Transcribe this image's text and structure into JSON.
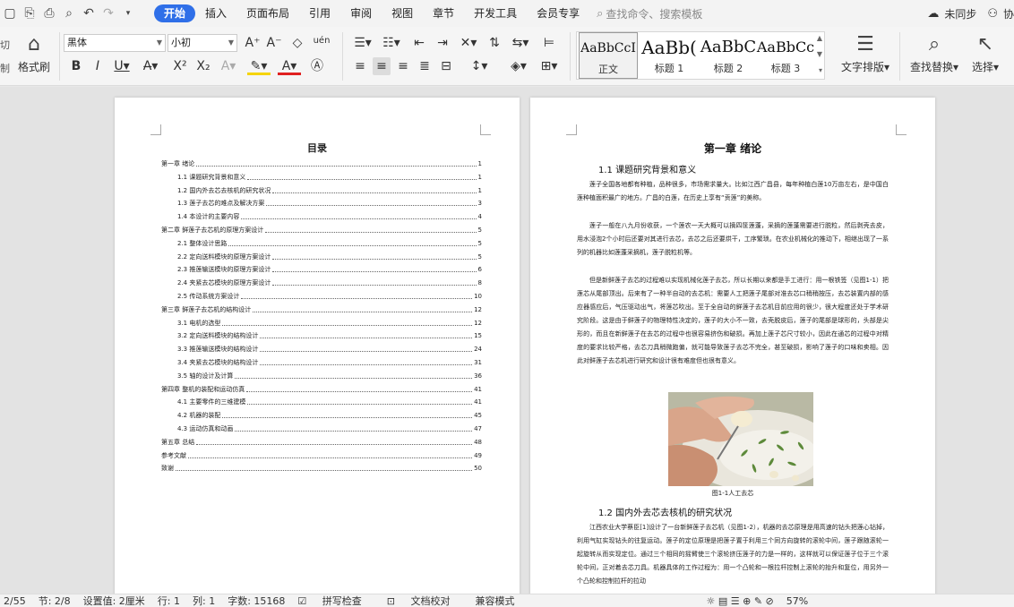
{
  "menu": {
    "tabs": [
      "开始",
      "插入",
      "页面布局",
      "引用",
      "审阅",
      "视图",
      "章节",
      "开发工具",
      "会员专享"
    ],
    "search_placeholder": "查找命令、搜索模板",
    "sync": "未同步",
    "collab": "协"
  },
  "ribbon": {
    "cut": "切",
    "copy": "制",
    "format_painter": "格式刷",
    "font_name": "黑体",
    "font_size": "小初",
    "phonetic": "uén",
    "styles": [
      {
        "preview": "AaBbCcI",
        "label": "正文"
      },
      {
        "preview": "AaBb(",
        "label": "标题 1"
      },
      {
        "preview": "AaBbC",
        "label": "标题 2"
      },
      {
        "preview": "AaBbCc",
        "label": "标题 3"
      }
    ],
    "text_layout": "文字排版",
    "find_replace": "查找替换",
    "select": "选择"
  },
  "toc": {
    "title": "目录",
    "items": [
      {
        "label": "第一章  绪论",
        "page": "1"
      },
      {
        "label": "1.1    课题研究背景和意义",
        "page": "1"
      },
      {
        "label": "1.2    国内外去芯去核机的研究状况",
        "page": "1"
      },
      {
        "label": "1.3    莲子去芯的难点及解决方案",
        "page": "3"
      },
      {
        "label": "1.4    本设计的主要内容",
        "page": "4"
      },
      {
        "label": "第二章  鲜莲子去芯机的原理方案设计",
        "page": "5"
      },
      {
        "label": "2.1    整体设计思路",
        "page": "5"
      },
      {
        "label": "2.2    定向送料模块的原理方案设计",
        "page": "5"
      },
      {
        "label": "2.3    推莲输送模块的原理方案设计",
        "page": "6"
      },
      {
        "label": "2.4    夹紧去芯模块的原理方案设计",
        "page": "8"
      },
      {
        "label": "2.5    传动系统方案设计",
        "page": "10"
      },
      {
        "label": "第三章  鲜莲子去芯机的结构设计",
        "page": "12"
      },
      {
        "label": "3.1    电机的选型",
        "page": "12"
      },
      {
        "label": "3.2    定向送料模块的结构设计",
        "page": "15"
      },
      {
        "label": "3.3    推莲输送模块的结构设计",
        "page": "24"
      },
      {
        "label": "3.4    夹紧去芯模块的结构设计",
        "page": "31"
      },
      {
        "label": "3.5    轴的设计及计算",
        "page": "36"
      },
      {
        "label": "第四章  整机的装配和运动仿真",
        "page": "41"
      },
      {
        "label": "4.1    主要零件的三维建模",
        "page": "41"
      },
      {
        "label": "4.2    机器的装配",
        "page": "45"
      },
      {
        "label": "4.3    运动仿真和动画",
        "page": "47"
      },
      {
        "label": "第五章  总结",
        "page": "48"
      },
      {
        "label": "参考文献",
        "page": "49"
      },
      {
        "label": "致谢",
        "page": "50"
      }
    ]
  },
  "content": {
    "chapter_title": "第一章  绪论",
    "section1_title": "1.1   课题研究背景和意义",
    "p1": "莲子全国各地都有种植，品种很多，市场需求量大。比如江西广昌县，每年种植白莲10万亩左右，是中国白莲种植面积最广的地方。广昌的白莲，在历史上享有“贡莲”的美称。",
    "p2": "莲子一般在八九月份收获，一个莲农一天大概可以摘四筐莲蓬，采摘的莲蓬需要进行脱粒，然后剥壳去皮，用水浸泡2个小时后还要对其进行去芯，去芯之后还要烘干，工序繁琐。在农业机械化的推动下，相继出现了一系列的机器比如莲蓬采摘机，莲子脱粒机等。",
    "p3": "但是新鲜莲子去芯的过程难以实现机械化莲子去芯，所以长期以来都是手工进行：用一根铁签（见图1-1）把莲芯从尾部顶出。后来有了一种半自动的去芯机：需要人工把莲子尾部对准去芯口稍稍按压，去芯装置内部的感应器感应后，气压驱动出气，将莲芯吹出。至于全自动的鲜莲子去芯机目前应用的很少，很大程度还处于学术研究阶段。这是由于鲜莲子的物理特性决定的，莲子的大小不一致，去壳脱皮后，莲子的尾部是球形的，头部是尖形的，而且在新鲜莲子在去芯的过程中也很容易挤伤和破损。再加上莲子芯尺寸较小，因此在通芯的过程中对精度的要求比较严格，去芯刀具稍微跑偏，就可能导致莲子去芯不完全，甚至破损，影响了莲子的口味和卖相。因此对鲜莲子去芯机进行研究和设计很有难度但也很有意义。",
    "figure_caption": "图1-1人工去芯",
    "section2_title": "1.2   国内外去芯去核机的研究状况",
    "p4": "江西农业大学蔡臣[1]设计了一台新鲜莲子去芯机（见图1-2），机器的去芯原理是用高速的钻头把莲心钻掉，利用气缸实现钻头的往复运动。莲子的定位原理是把莲子置于利用三个同方向旋转的滚轮中间，莲子跟随滚轮一起旋转从而实现定位。通过三个相同的摇臂使三个滚轮挤压莲子的力是一样的，这样就可以保证莲子位于三个滚轮中间，正对着去芯刀具。机器具体的工作过程为：用一个凸轮和一根拉杆控制上滚轮的抬升和复位，用另外一个凸轮和控制拉杆的拉动"
  },
  "status": {
    "page": "2/55",
    "section": "节: 2/8",
    "setting": "设置值: 2厘米",
    "row": "行: 1",
    "col": "列: 1",
    "words": "字数: 15168",
    "spell": "拼写检查",
    "proof": "文档校对",
    "compat": "兼容模式",
    "zoom": "57%"
  }
}
